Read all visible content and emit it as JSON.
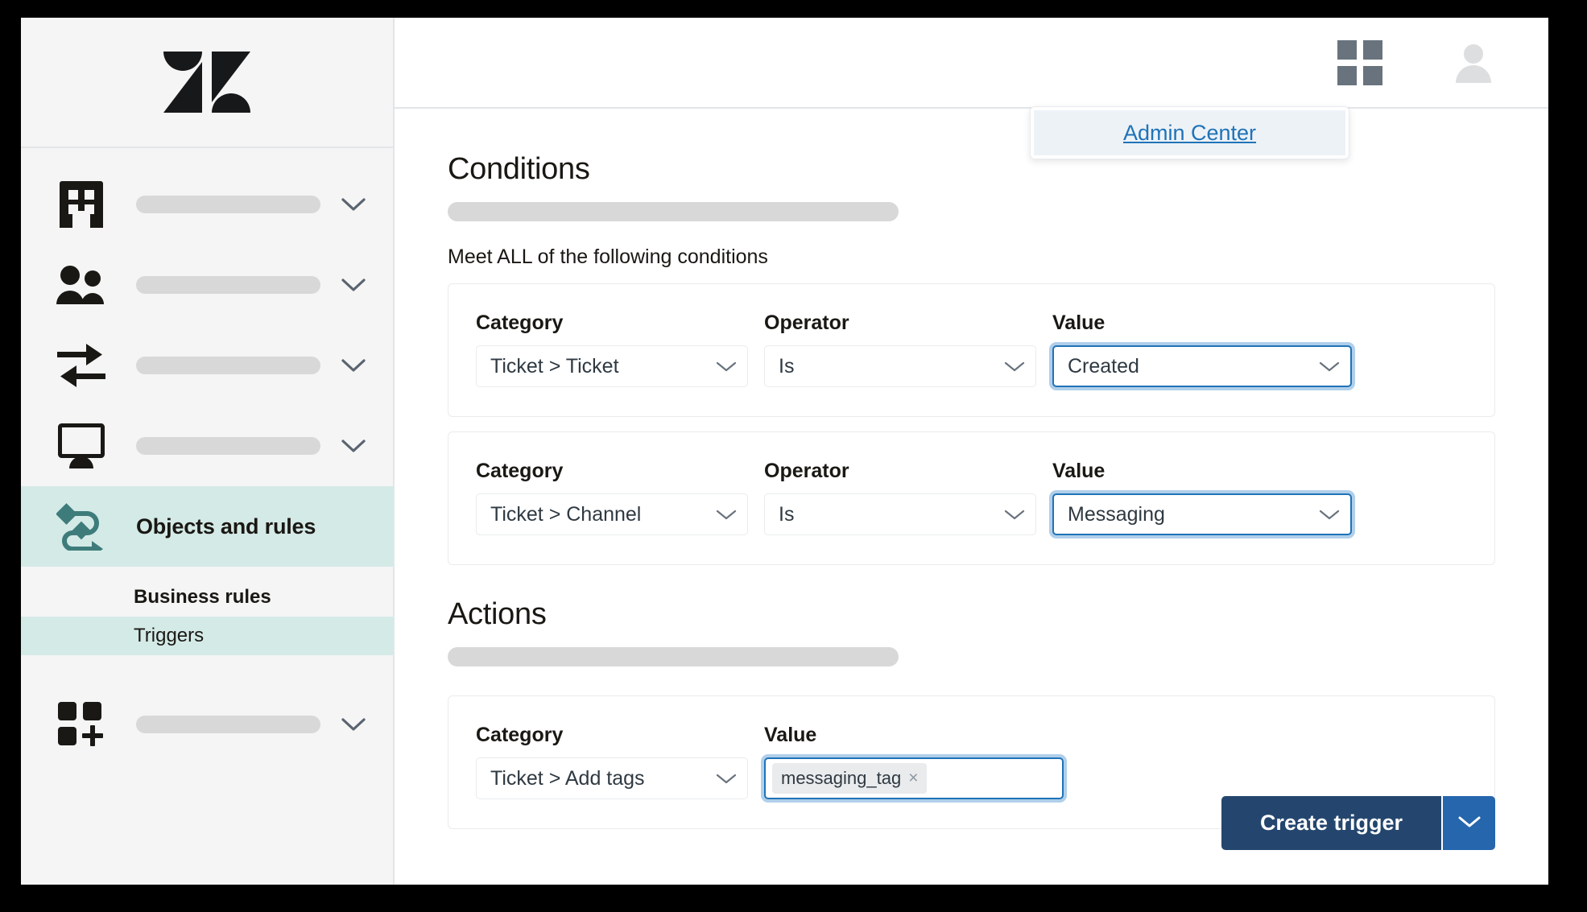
{
  "sidebar": {
    "logo": "zendesk-logo",
    "items": [
      {
        "icon": "building-icon",
        "label": "",
        "caret": true
      },
      {
        "icon": "people-icon",
        "label": "",
        "caret": true
      },
      {
        "icon": "arrows-exchange-icon",
        "label": "",
        "caret": true
      },
      {
        "icon": "monitor-icon",
        "label": "",
        "caret": true
      },
      {
        "icon": "objects-rules-icon",
        "label": "Objects and rules",
        "caret": false,
        "active": true
      },
      {
        "icon": "apps-add-icon",
        "label": "",
        "caret": true
      }
    ],
    "sub_items": [
      {
        "label": "Business rules",
        "bold": true,
        "selected": false
      },
      {
        "label": "Triggers",
        "bold": false,
        "selected": true
      }
    ]
  },
  "topbar": {
    "grid_icon": "apps-grid-icon",
    "avatar_icon": "user-avatar-icon",
    "flyout": {
      "link_label": "Admin Center",
      "link_color": "#1f73b7"
    }
  },
  "conditions": {
    "title": "Conditions",
    "meet_label": "Meet ALL of the following conditions",
    "rows": [
      {
        "category_label": "Category",
        "category_value": "Ticket > Ticket",
        "operator_label": "Operator",
        "operator_value": "Is",
        "value_label": "Value",
        "value_value": "Created",
        "value_focused": true
      },
      {
        "category_label": "Category",
        "category_value": "Ticket > Channel",
        "operator_label": "Operator",
        "operator_value": "Is",
        "value_label": "Value",
        "value_value": "Messaging",
        "value_focused": true
      }
    ]
  },
  "actions": {
    "title": "Actions",
    "row": {
      "category_label": "Category",
      "category_value": "Ticket > Add tags",
      "value_label": "Value",
      "tags": [
        {
          "text": "messaging_tag",
          "remove": "×"
        }
      ]
    }
  },
  "footer": {
    "create_label": "Create trigger",
    "caret_icon": "chevron-down-icon",
    "primary_color": "#24466e",
    "caret_color": "#2566ad"
  }
}
